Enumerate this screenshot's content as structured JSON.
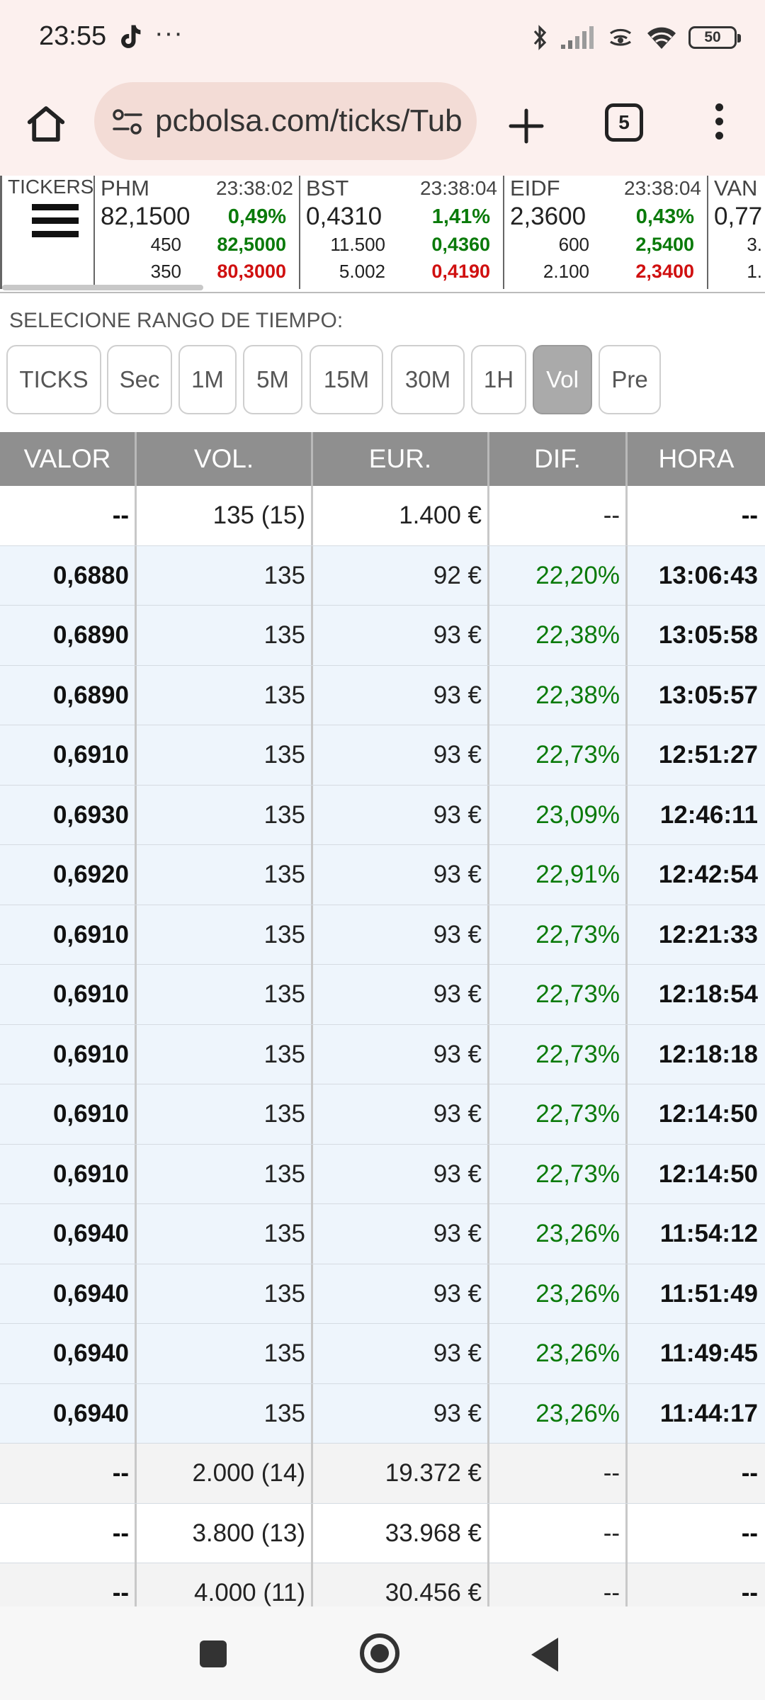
{
  "status_bar": {
    "time": "23:55",
    "dots": "···",
    "battery": "50",
    "icons": [
      "tiktok-icon",
      "bluetooth-icon",
      "signal-icon",
      "hotspot-icon",
      "wifi-icon",
      "battery-icon"
    ]
  },
  "browser": {
    "url": "pcbolsa.com/ticks/Tub",
    "tab_count": "5"
  },
  "tickers": {
    "menu_label": "TICKERS",
    "items": [
      {
        "symbol": "PHM",
        "time": "23:38:02",
        "price": "82,1500",
        "change": "0,49%",
        "vol_high": "450",
        "high": "82,5000",
        "vol_low": "350",
        "low": "80,3000"
      },
      {
        "symbol": "BST",
        "time": "23:38:04",
        "price": "0,4310",
        "change": "1,41%",
        "vol_high": "11.500",
        "high": "0,4360",
        "vol_low": "5.002",
        "low": "0,4190"
      },
      {
        "symbol": "EIDF",
        "time": "23:38:04",
        "price": "2,3600",
        "change": "0,43%",
        "vol_high": "600",
        "high": "2,5400",
        "vol_low": "2.100",
        "low": "2,3400"
      },
      {
        "symbol": "VAN",
        "time": "",
        "price": "0,77",
        "change": "",
        "vol_high": "3.",
        "high": "",
        "vol_low": "1.",
        "low": ""
      }
    ]
  },
  "range": {
    "label": "SELECIONE RANGO DE TIEMPO:",
    "buttons": [
      "TICKS",
      "Sec",
      "1M",
      "5M",
      "15M",
      "30M",
      "1H",
      "Vol",
      "Pre"
    ],
    "active": "Vol"
  },
  "table": {
    "headers": [
      "VALOR",
      "VOL.",
      "EUR.",
      "DIF.",
      "HORA"
    ],
    "rows": [
      {
        "valor": "--",
        "vol": "135 (15)",
        "eur": "1.400 €",
        "dif": "--",
        "hora": "--",
        "type": "summary"
      },
      {
        "valor": "0,6880",
        "vol": "135",
        "eur": "92 €",
        "dif": "22,20%",
        "hora": "13:06:43",
        "type": "tick"
      },
      {
        "valor": "0,6890",
        "vol": "135",
        "eur": "93 €",
        "dif": "22,38%",
        "hora": "13:05:58",
        "type": "tick"
      },
      {
        "valor": "0,6890",
        "vol": "135",
        "eur": "93 €",
        "dif": "22,38%",
        "hora": "13:05:57",
        "type": "tick"
      },
      {
        "valor": "0,6910",
        "vol": "135",
        "eur": "93 €",
        "dif": "22,73%",
        "hora": "12:51:27",
        "type": "tick"
      },
      {
        "valor": "0,6930",
        "vol": "135",
        "eur": "93 €",
        "dif": "23,09%",
        "hora": "12:46:11",
        "type": "tick"
      },
      {
        "valor": "0,6920",
        "vol": "135",
        "eur": "93 €",
        "dif": "22,91%",
        "hora": "12:42:54",
        "type": "tick"
      },
      {
        "valor": "0,6910",
        "vol": "135",
        "eur": "93 €",
        "dif": "22,73%",
        "hora": "12:21:33",
        "type": "tick"
      },
      {
        "valor": "0,6910",
        "vol": "135",
        "eur": "93 €",
        "dif": "22,73%",
        "hora": "12:18:54",
        "type": "tick"
      },
      {
        "valor": "0,6910",
        "vol": "135",
        "eur": "93 €",
        "dif": "22,73%",
        "hora": "12:18:18",
        "type": "tick"
      },
      {
        "valor": "0,6910",
        "vol": "135",
        "eur": "93 €",
        "dif": "22,73%",
        "hora": "12:14:50",
        "type": "tick"
      },
      {
        "valor": "0,6910",
        "vol": "135",
        "eur": "93 €",
        "dif": "22,73%",
        "hora": "12:14:50",
        "type": "tick"
      },
      {
        "valor": "0,6940",
        "vol": "135",
        "eur": "93 €",
        "dif": "23,26%",
        "hora": "11:54:12",
        "type": "tick"
      },
      {
        "valor": "0,6940",
        "vol": "135",
        "eur": "93 €",
        "dif": "23,26%",
        "hora": "11:51:49",
        "type": "tick"
      },
      {
        "valor": "0,6940",
        "vol": "135",
        "eur": "93 €",
        "dif": "23,26%",
        "hora": "11:49:45",
        "type": "tick"
      },
      {
        "valor": "0,6940",
        "vol": "135",
        "eur": "93 €",
        "dif": "23,26%",
        "hora": "11:44:17",
        "type": "tick"
      },
      {
        "valor": "--",
        "vol": "2.000 (14)",
        "eur": "19.372 €",
        "dif": "--",
        "hora": "--",
        "type": "summary-alt"
      },
      {
        "valor": "--",
        "vol": "3.800 (13)",
        "eur": "33.968 €",
        "dif": "--",
        "hora": "--",
        "type": "summary"
      },
      {
        "valor": "--",
        "vol": "4.000 (11)",
        "eur": "30.456 €",
        "dif": "--",
        "hora": "--",
        "type": "summary-alt"
      }
    ]
  },
  "colors": {
    "positive": "#0a7a0a",
    "negative": "#d01010",
    "tick_row_bg": "#eef5fc",
    "summary_row_bg": "#ffffff",
    "summary_alt_bg": "#f3f3f3",
    "header_bg": "#8f8f8f",
    "chrome_bg": "#fcf0ee"
  }
}
